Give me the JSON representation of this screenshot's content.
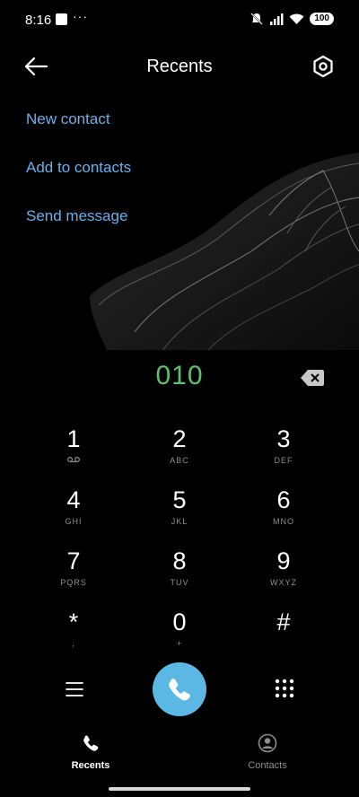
{
  "status_bar": {
    "time": "8:16",
    "more_indicator": "···",
    "battery": "100",
    "icons": [
      "mute-icon",
      "signal-icon",
      "wifi-icon",
      "battery-icon"
    ]
  },
  "header": {
    "title": "Recents",
    "back_icon": "arrow-left-icon",
    "settings_icon": "settings-icon"
  },
  "actions": {
    "new_contact": "New contact",
    "add_to_contacts": "Add to contacts",
    "send_message": "Send message"
  },
  "dialer": {
    "number": "010",
    "backspace_icon": "backspace-icon",
    "keys": [
      {
        "digit": "1",
        "letters": "",
        "sub_icon": "voicemail-icon"
      },
      {
        "digit": "2",
        "letters": "ABC"
      },
      {
        "digit": "3",
        "letters": "DEF"
      },
      {
        "digit": "4",
        "letters": "GHI"
      },
      {
        "digit": "5",
        "letters": "JKL"
      },
      {
        "digit": "6",
        "letters": "MNO"
      },
      {
        "digit": "7",
        "letters": "PQRS"
      },
      {
        "digit": "8",
        "letters": "TUV"
      },
      {
        "digit": "9",
        "letters": "WXYZ"
      },
      {
        "digit": "*",
        "letters": ","
      },
      {
        "digit": "0",
        "letters": "+"
      },
      {
        "digit": "#",
        "letters": ""
      }
    ]
  },
  "controls": {
    "menu_icon": "menu-icon",
    "call_icon": "phone-icon",
    "keypad_icon": "dialpad-icon",
    "call_color": "#5bb8e4"
  },
  "nav": {
    "recents_label": "Recents",
    "contacts_label": "Contacts",
    "active": "recents"
  },
  "colors": {
    "link": "#6ab0ea",
    "number": "#5bc16b",
    "background": "#000000"
  }
}
